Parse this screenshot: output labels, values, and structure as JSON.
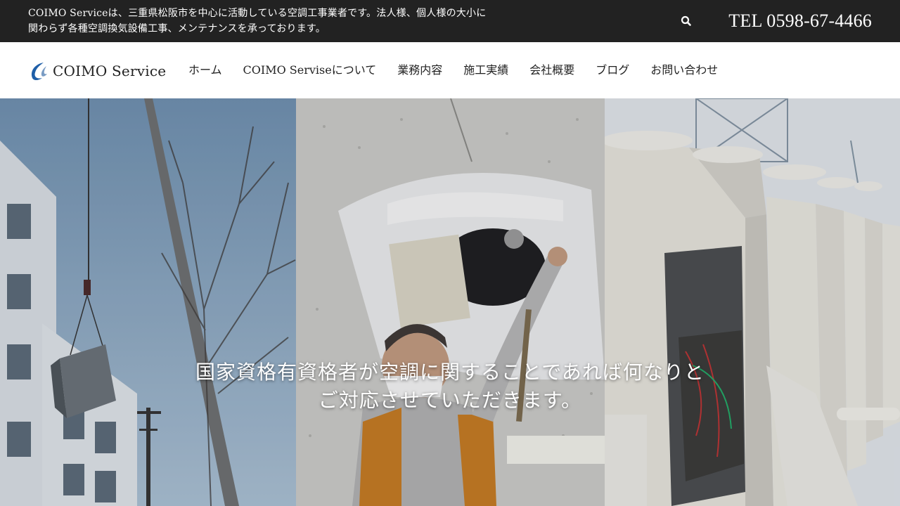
{
  "topbar": {
    "description_line1": "COIMO Serviceは、三重県松阪市を中心に活動している空調工事業者です。法人様、個人様の大小に",
    "description_line2": "関わらず各種空調換気設備工事、メンテナンスを承っております。",
    "search_icon": "search-icon",
    "tel": "TEL 0598-67-4466"
  },
  "header": {
    "logo_text": "COIMO Service",
    "nav": [
      {
        "label": "ホーム"
      },
      {
        "label": "COIMO Serviseについて"
      },
      {
        "label": "業務内容"
      },
      {
        "label": "施工実績"
      },
      {
        "label": "会社概要"
      },
      {
        "label": "ブログ"
      },
      {
        "label": "お問い合わせ"
      }
    ]
  },
  "hero": {
    "catch_line1": "国家資格有資格者が空調に関することであれば何なりと",
    "catch_line2": "ご対応させていただきます。"
  },
  "colors": {
    "topbar_bg": "#222222",
    "logo_blue": "#1f5fa8",
    "text": "#222222"
  }
}
